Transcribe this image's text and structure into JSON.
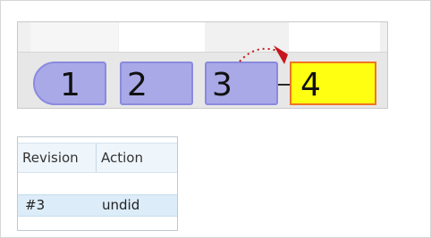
{
  "revision_strip": {
    "revisions": [
      {
        "label": "1",
        "state": "past"
      },
      {
        "label": "2",
        "state": "past"
      },
      {
        "label": "3",
        "state": "past"
      },
      {
        "label": "4",
        "state": "current"
      }
    ],
    "colors": {
      "past_fill": "#a9a9e8",
      "past_border": "#8a8adf",
      "current_fill": "#ffff11",
      "current_border": "#f07522",
      "arrow": "#c4161c"
    },
    "arrow_icon": "undo-arrow-icon"
  },
  "revision_table": {
    "columns": [
      "Revision",
      "Action"
    ],
    "rows": [
      {
        "revision": "",
        "action": ""
      },
      {
        "revision": "#3",
        "action": "undid",
        "selected": true
      }
    ]
  }
}
